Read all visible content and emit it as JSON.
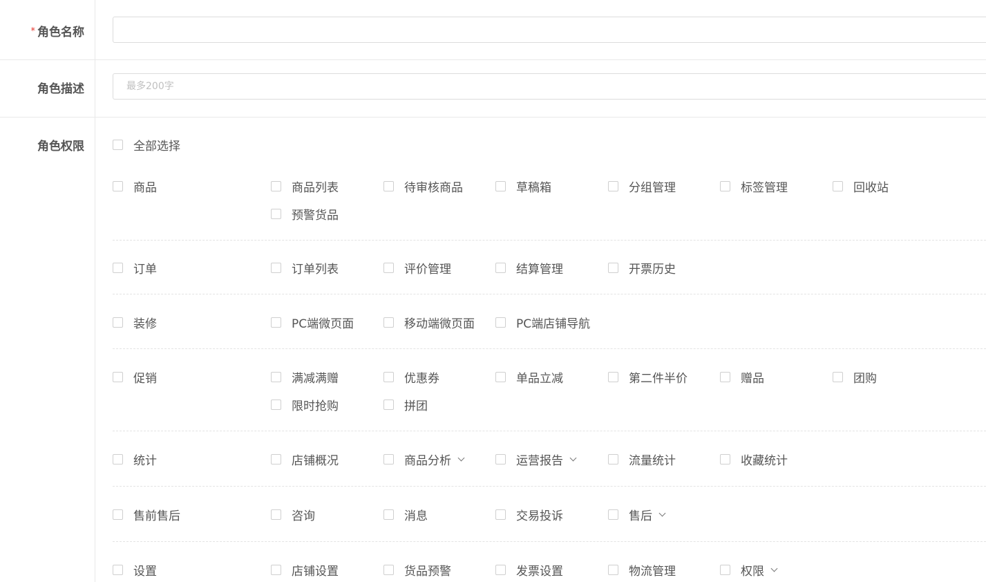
{
  "fields": {
    "name": {
      "label": "角色名称",
      "required_mark": "*",
      "value": ""
    },
    "desc": {
      "label": "角色描述",
      "placeholder": "最多200字",
      "value": ""
    },
    "perm": {
      "label": "角色权限",
      "select_all": "全部选择"
    }
  },
  "groups": [
    {
      "name": "商品",
      "items": [
        {
          "label": "商品列表"
        },
        {
          "label": "待审核商品"
        },
        {
          "label": "草稿箱"
        },
        {
          "label": "分组管理"
        },
        {
          "label": "标签管理"
        },
        {
          "label": "回收站"
        },
        {
          "label": "预警货品"
        }
      ]
    },
    {
      "name": "订单",
      "items": [
        {
          "label": "订单列表"
        },
        {
          "label": "评价管理"
        },
        {
          "label": "结算管理"
        },
        {
          "label": "开票历史"
        }
      ]
    },
    {
      "name": "装修",
      "items": [
        {
          "label": "PC端微页面"
        },
        {
          "label": "移动端微页面"
        },
        {
          "label": "PC端店铺导航"
        }
      ]
    },
    {
      "name": "促销",
      "items": [
        {
          "label": "满减满赠"
        },
        {
          "label": "优惠券"
        },
        {
          "label": "单品立减"
        },
        {
          "label": "第二件半价"
        },
        {
          "label": "赠品"
        },
        {
          "label": "团购"
        },
        {
          "label": "限时抢购"
        },
        {
          "label": "拼团"
        }
      ]
    },
    {
      "name": "统计",
      "items": [
        {
          "label": "店铺概况"
        },
        {
          "label": "商品分析",
          "expand": true
        },
        {
          "label": "运营报告",
          "expand": true
        },
        {
          "label": "流量统计"
        },
        {
          "label": "收藏统计"
        }
      ]
    },
    {
      "name": "售前售后",
      "items": [
        {
          "label": "咨询"
        },
        {
          "label": "消息"
        },
        {
          "label": "交易投诉"
        },
        {
          "label": "售后",
          "expand": true
        }
      ]
    },
    {
      "name": "设置",
      "items": [
        {
          "label": "店铺设置"
        },
        {
          "label": "货品预警"
        },
        {
          "label": "发票设置"
        },
        {
          "label": "物流管理"
        },
        {
          "label": "权限",
          "expand": true
        }
      ]
    }
  ]
}
